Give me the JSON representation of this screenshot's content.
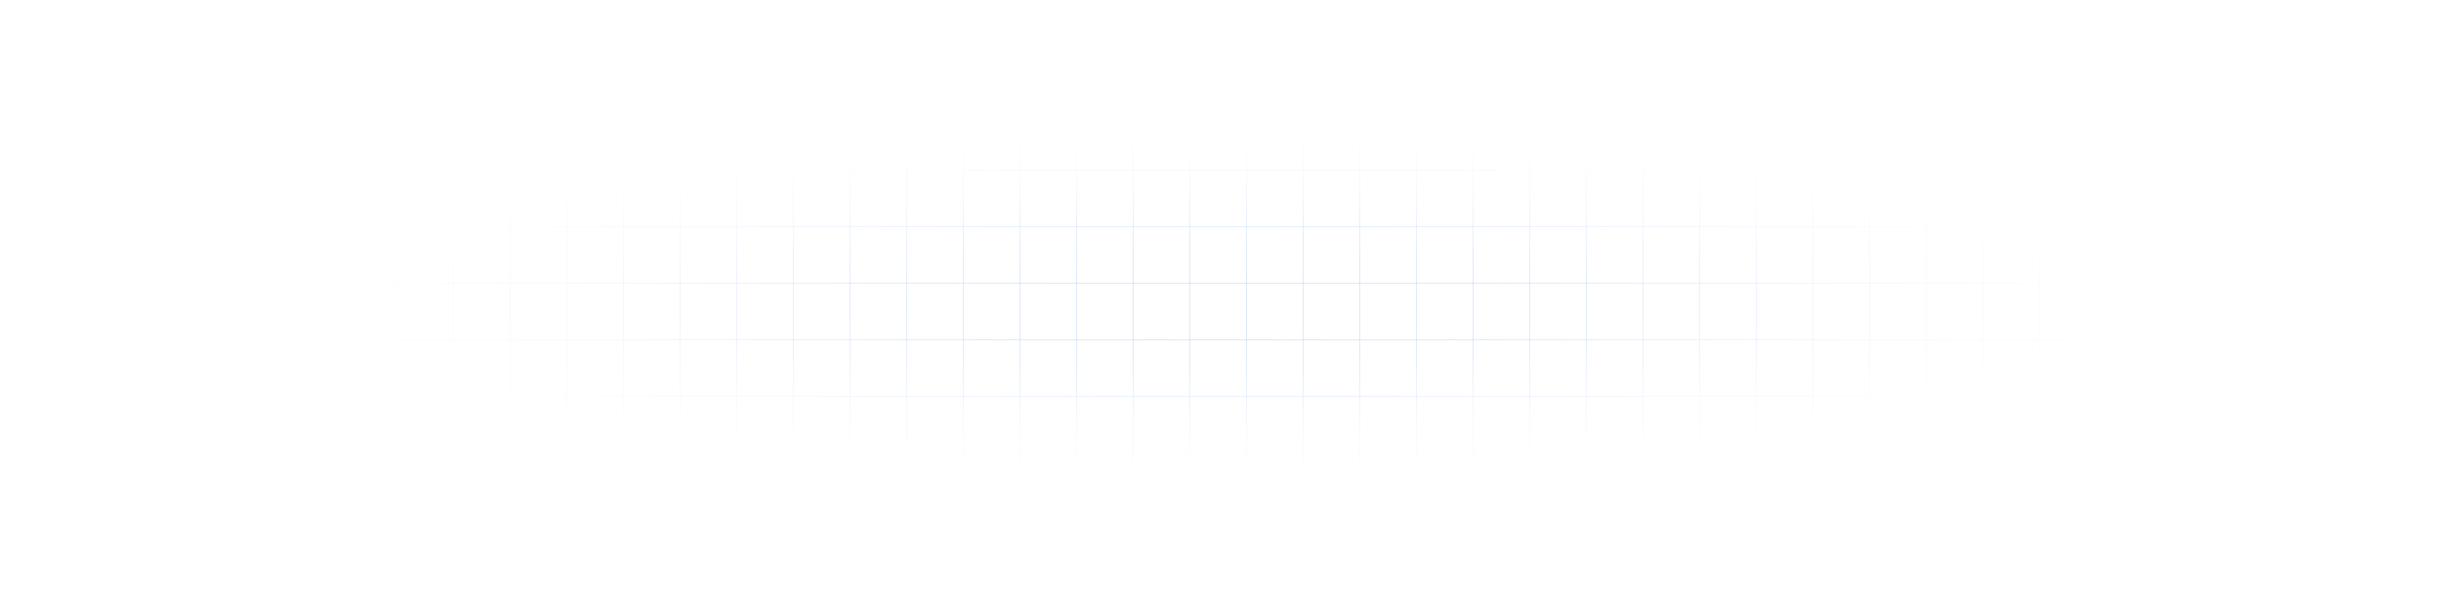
{
  "background_color": "#ffffff",
  "grid": {
    "line_color": "#3f7fe0",
    "fade": "radial-ellipse",
    "description_visible_text": ""
  }
}
